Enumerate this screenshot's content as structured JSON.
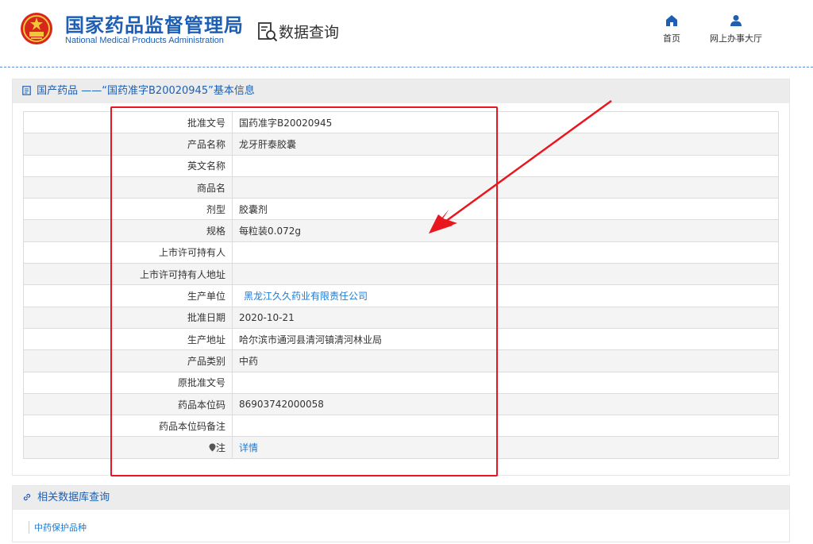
{
  "header": {
    "org_name_cn": "国家药品监督管理局",
    "org_name_en": "National Medical Products Administration",
    "section_title": "数据查询",
    "nav": [
      {
        "label": "首页",
        "icon": "home-icon"
      },
      {
        "label": "网上办事大厅",
        "icon": "user-icon"
      }
    ]
  },
  "detail": {
    "title": "国产药品 ——“国药准字B20020945”基本信息",
    "rows": [
      {
        "label": "批准文号",
        "value": "国药准字B20020945"
      },
      {
        "label": "产品名称",
        "value": "龙牙肝泰胶囊"
      },
      {
        "label": "英文名称",
        "value": ""
      },
      {
        "label": "商品名",
        "value": ""
      },
      {
        "label": "剂型",
        "value": "胶囊剂"
      },
      {
        "label": "规格",
        "value": "每粒装0.072g"
      },
      {
        "label": "上市许可持有人",
        "value": ""
      },
      {
        "label": "上市许可持有人地址",
        "value": ""
      },
      {
        "label": "生产单位",
        "value": "黑龙江久久药业有限责任公司"
      },
      {
        "label": "批准日期",
        "value": "2020-10-21"
      },
      {
        "label": "生产地址",
        "value": "哈尔滨市通河县清河镇清河林业局"
      },
      {
        "label": "产品类别",
        "value": "中药"
      },
      {
        "label": "原批准文号",
        "value": ""
      },
      {
        "label": "药品本位码",
        "value": "86903742000058"
      },
      {
        "label": "药品本位码备注",
        "value": ""
      },
      {
        "label": "注",
        "value": "详情"
      }
    ]
  },
  "related": {
    "title": "相关数据库查询",
    "links": [
      "中药保护品种"
    ]
  },
  "colors": {
    "brand_blue": "#1c5fb4",
    "link_blue": "#1c7bd6",
    "annotation_red": "#e8171f"
  }
}
